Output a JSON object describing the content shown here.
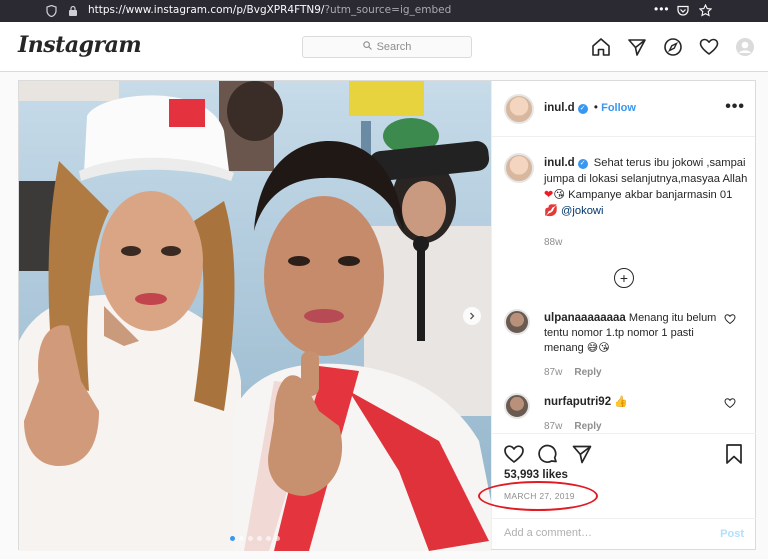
{
  "browser": {
    "url_host": "https://www.instagram.com",
    "url_path": "/p/BvgXPR4FTN9/",
    "url_query": "?utm_source=ig_embed"
  },
  "header": {
    "logo": "Instagram",
    "search_placeholder": "Search",
    "icons": [
      "home-icon",
      "direct-icon",
      "explore-icon",
      "activity-heart-icon",
      "profile-avatar"
    ]
  },
  "post": {
    "username": "inul.d",
    "follow_label": "Follow",
    "more_label": "•••",
    "caption_part1": "Sehat terus ibu jokowi ,sampai jumpa di lokasi selanjutnya,masyaa Allah",
    "caption_part2": "Kampanye akbar banjarmasin 01",
    "caption_mention": "@jokowi",
    "caption_age": "88w",
    "load_more": "+",
    "comments": [
      {
        "user": "ulpanaaaaaaaa",
        "text": "Menang itu belum tentu nomor 1.tp nomor 1 pasti menang 😅😘",
        "age": "87w",
        "reply": "Reply"
      },
      {
        "user": "nurfaputri92",
        "text": "👍",
        "age": "87w",
        "reply": "Reply"
      }
    ],
    "likes": "53,993 likes",
    "date": "MARCH 27, 2019",
    "add_comment_placeholder": "Add a comment…",
    "post_button": "Post",
    "carousel": {
      "count": 6,
      "active_index": 0
    }
  },
  "colors": {
    "accent_blue": "#3897f0",
    "annotation_red": "#e21b23"
  }
}
